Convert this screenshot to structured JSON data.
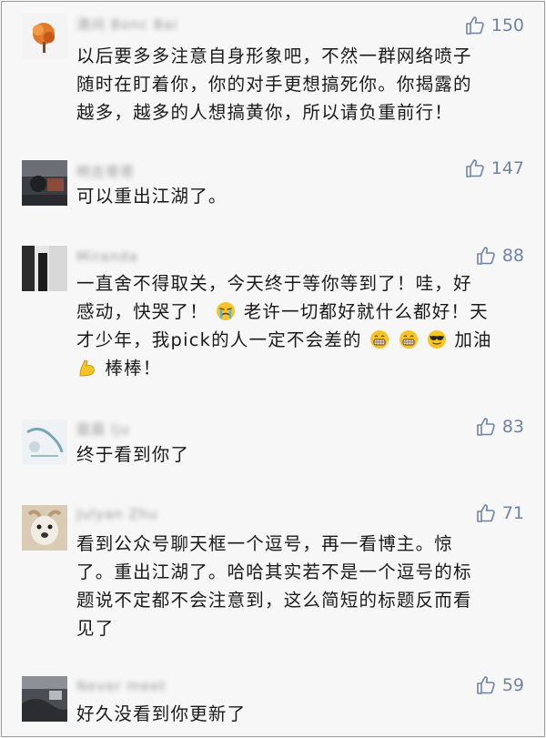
{
  "comments": [
    {
      "name": "清问 Bonc Bai",
      "likes": "150",
      "lines": [
        "以后要多多注意自身形象吧，不然一群网络喷子",
        "随时在盯着你，你的对手更想搞死你。你揭露的",
        "越多，越多的人想搞黄你，所以请负重前行！"
      ]
    },
    {
      "name": "明吉哥哥",
      "likes": "147",
      "lines": [
        "可以重出江湖了。"
      ]
    },
    {
      "name": "Miranda",
      "likes": "88",
      "line1": "一直舍不得取关，今天终于等你等到了！哇，好",
      "line2a": "感动，快哭了！",
      "line2b": "老许一切都好就什么都好！天",
      "line3a": "才少年，我pick的人一定不会差的",
      "line3b": "加油",
      "line4": "棒棒！"
    },
    {
      "name": "眉眉 lju",
      "likes": "83",
      "lines": [
        "终于看到你了"
      ]
    },
    {
      "name": "Julyan Zhu",
      "likes": "71",
      "lines": [
        "看到公众号聊天框一个逗号，再一看博主。惊",
        "了。重出江湖了。哈哈其实若不是一个逗号的标",
        "题说不定都不会注意到，这么简短的标题反而看",
        "见了"
      ]
    },
    {
      "name": "Never meet",
      "likes": "59",
      "lines": [
        "好久没看到你更新了"
      ]
    }
  ],
  "colors": {
    "background": "#f7f7f7",
    "like_accent": "#6f84a3",
    "text": "#1a1a1a"
  },
  "icons": {
    "like": "thumbs-up-outline-icon",
    "emoji_1": "crying-face-emoji",
    "emoji_2": "grinning-face-emoji",
    "emoji_3": "sunglasses-face-emoji",
    "emoji_4": "flexed-biceps-emoji"
  }
}
